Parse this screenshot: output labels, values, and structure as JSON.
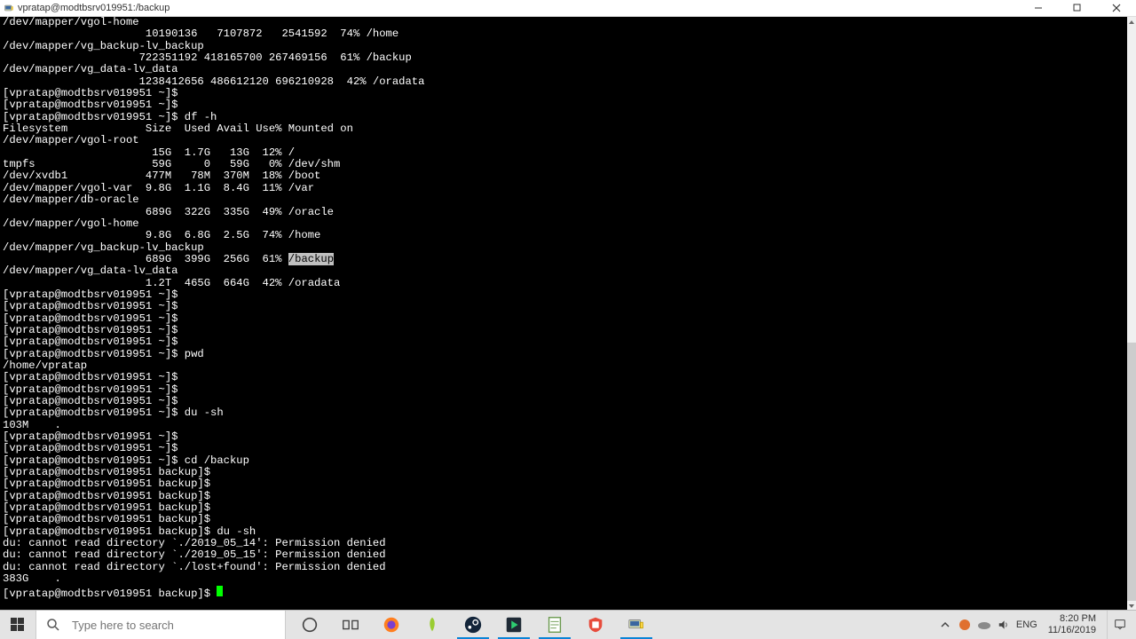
{
  "window": {
    "title": "vpratap@modtbsrv019951:/backup"
  },
  "terminal": {
    "prompt_home": "[vpratap@modtbsrv019951 ~]$ ",
    "prompt_backup": "[vpratap@modtbsrv019951 backup]$ ",
    "lines_top": [
      "/dev/mapper/vgol-home",
      "                      10190136   7107872   2541592  74% /home",
      "/dev/mapper/vg_backup-lv_backup",
      "                     722351192 418165700 267469156  61% /backup",
      "/dev/mapper/vg_data-lv_data",
      "                     1238412656 486612120 696210928  42% /oradata"
    ],
    "cmd_dfh": "df -h",
    "dfh_header": "Filesystem            Size  Used Avail Use% Mounted on",
    "dfh_rows": [
      "/dev/mapper/vgol-root",
      "                       15G  1.7G   13G  12% /",
      "tmpfs                  59G     0   59G   0% /dev/shm",
      "/dev/xvdb1            477M   78M  370M  18% /boot",
      "/dev/mapper/vgol-var  9.8G  1.1G  8.4G  11% /var",
      "/dev/mapper/db-oracle",
      "                      689G  322G  335G  49% /oracle",
      "/dev/mapper/vgol-home",
      "                      9.8G  6.8G  2.5G  74% /home",
      "/dev/mapper/vg_backup-lv_backup",
      "                      689G  399G  256G  61% "
    ],
    "dfh_backup_hl": "/backup",
    "dfh_rows2": [
      "/dev/mapper/vg_data-lv_data",
      "                      1.2T  465G  664G  42% /oradata"
    ],
    "cmd_pwd": "pwd",
    "pwd_out": "/home/vpratap",
    "cmd_dush": "du -sh",
    "dush_out": "103M    .",
    "cmd_cd": "cd /backup",
    "cmd_dush2": "du -sh",
    "du_errors": [
      "du: cannot read directory `./2019_05_14': Permission denied",
      "du: cannot read directory `./2019_05_15': Permission denied",
      "du: cannot read directory `./lost+found': Permission denied"
    ],
    "dush2_out": "383G    ."
  },
  "taskbar": {
    "search_placeholder": "Type here to search",
    "lang": "ENG",
    "time": "8:20 PM",
    "date": "11/16/2019"
  }
}
